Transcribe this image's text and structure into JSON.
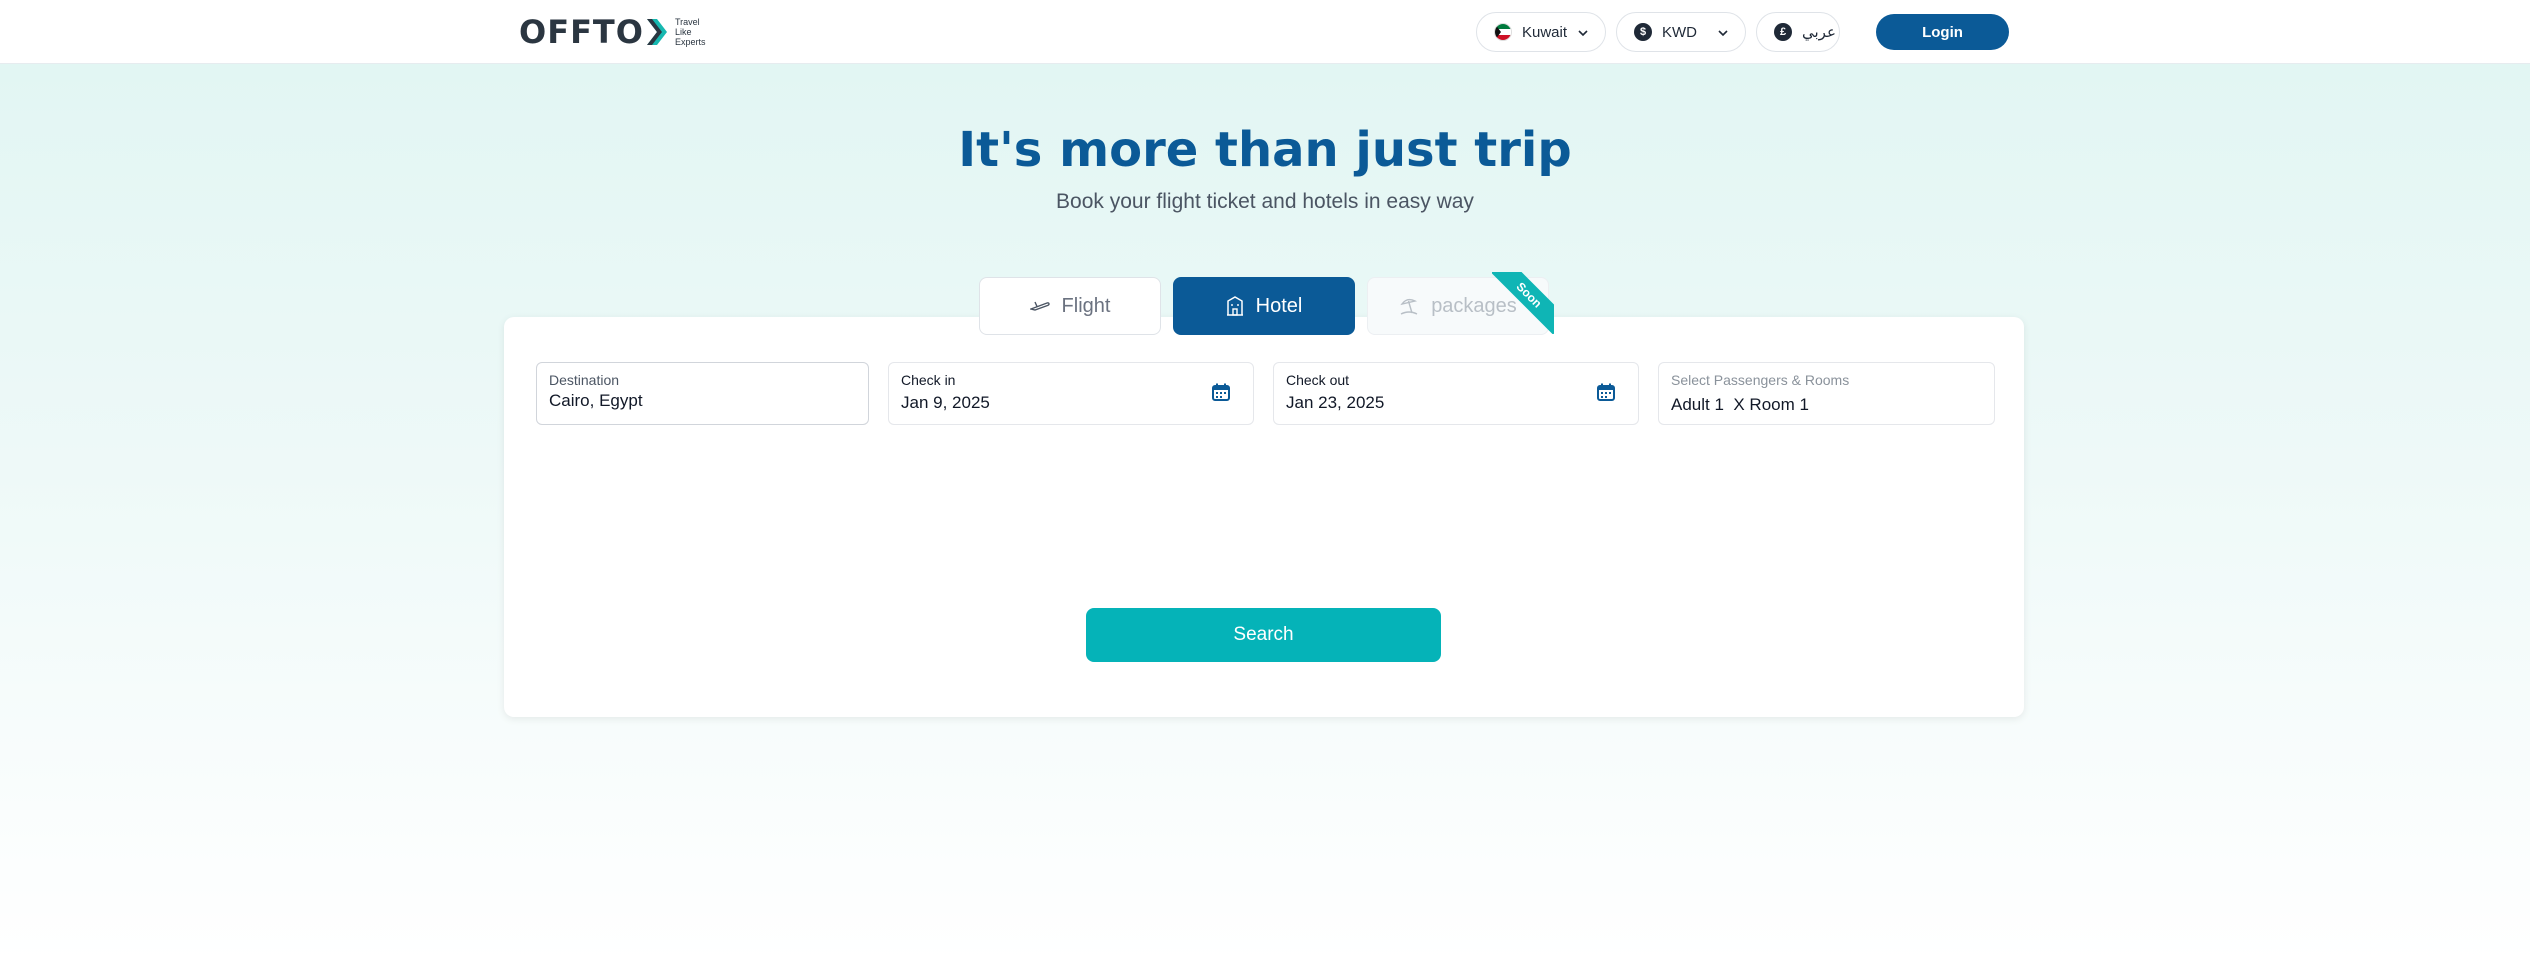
{
  "brand": {
    "logo_text": "OFFTO",
    "tagline": [
      "Travel",
      "Like",
      "Experts"
    ]
  },
  "header": {
    "country": "Kuwait",
    "currency": "KWD",
    "currency_symbol": "$",
    "language": "عربي",
    "language_symbol": "£",
    "login_label": "Login"
  },
  "hero": {
    "title": "It's more than just trip",
    "subtitle": "Book your flight ticket and hotels in easy way"
  },
  "tabs": [
    {
      "label": "Flight",
      "icon": "airplane-icon",
      "active": false
    },
    {
      "label": "Hotel",
      "icon": "hotel-building-icon",
      "active": true
    },
    {
      "label": "packages",
      "icon": "beach-umbrella-icon",
      "active": false,
      "badge": "Soon"
    }
  ],
  "form": {
    "destination": {
      "label": "Destination",
      "value": "Cairo, Egypt"
    },
    "check_in": {
      "label": "Check in",
      "value": "Jan 9, 2025"
    },
    "check_out": {
      "label": "Check out",
      "value": "Jan 23, 2025"
    },
    "passengers": {
      "label": "Select Passengers & Rooms",
      "value": "Adult 1  X Room 1"
    },
    "search_label": "Search"
  },
  "colors": {
    "primary": "#0b5a97",
    "accent": "#05b3b8",
    "ribbon": "#0fb5b5",
    "hero_bg": "#e2f6f3"
  }
}
